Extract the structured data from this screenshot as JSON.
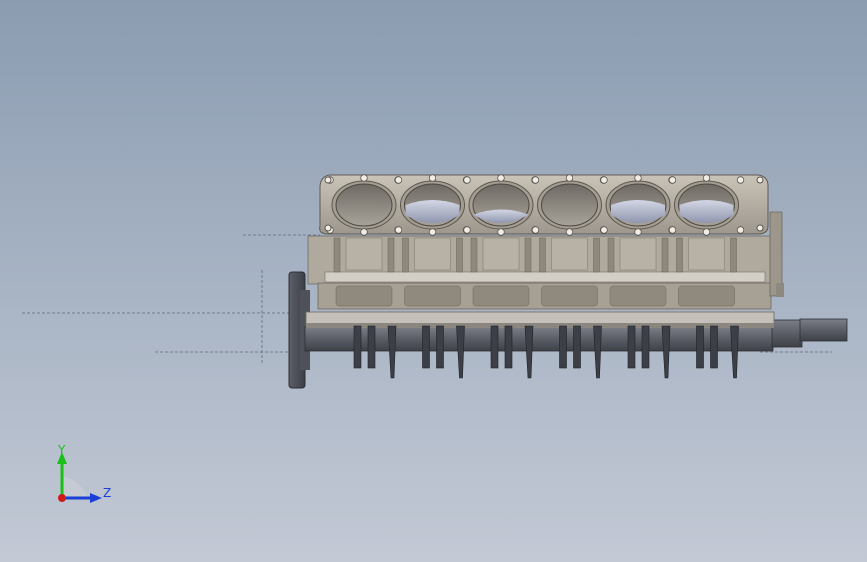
{
  "viewport": {
    "background_top": "#8b9cb1",
    "background_bottom": "#c3c9d5"
  },
  "model": {
    "name": "engine-block-assembly",
    "cylinder_count": 6,
    "body_color": "#b9b2a6",
    "shaft_color": "#4a4d55"
  },
  "triad": {
    "y_label": "Y",
    "z_label": "Z",
    "y_color": "#19c019",
    "z_color": "#1b3fd6",
    "x_color": "#d01a1a"
  }
}
